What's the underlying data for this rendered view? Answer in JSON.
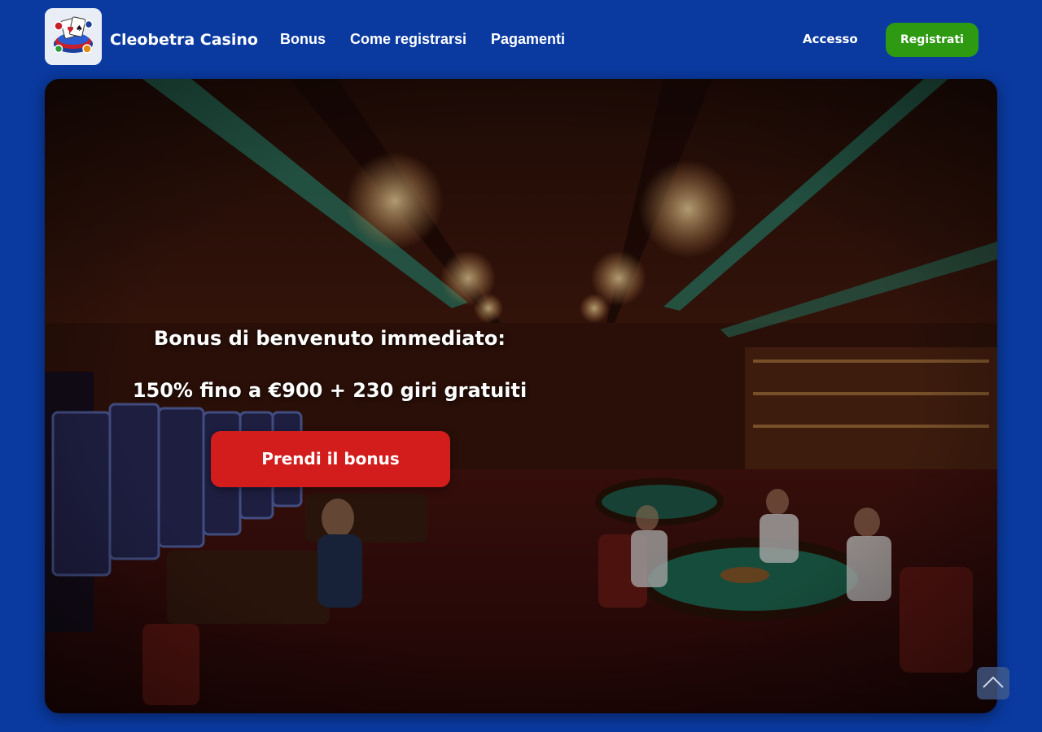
{
  "header": {
    "logo_icon": "casino-chips-cards-icon",
    "brand_name": "Cleobetra Casino",
    "nav": [
      {
        "label": "Bonus"
      },
      {
        "label": "Come registrarsi"
      },
      {
        "label": "Pagamenti"
      }
    ],
    "login_label": "Accesso",
    "register_label": "Registrati"
  },
  "hero": {
    "title": "Bonus di benvenuto immediato:",
    "offer": "150% fino a €900 + 230 giri gratuiti",
    "cta_label": "Prendi il bonus",
    "background_image": "casino-hall-interior"
  },
  "scroll_top": {
    "icon": "chevron-up-icon"
  },
  "colors": {
    "page_background": "#0a3aa0",
    "register_button": "#2e9a12",
    "cta_button": "#d31c1c",
    "text": "#ffffff"
  }
}
